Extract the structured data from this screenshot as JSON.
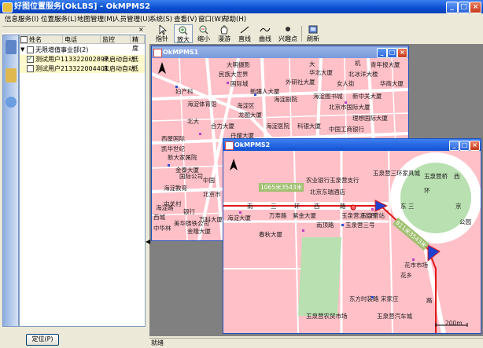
{
  "window": {
    "title": "好图位置服务[OkLBS] - OkMPMS2"
  },
  "menu": [
    "信息服务(I)",
    "位置服务(L)",
    "地图管理(M)",
    "人员管理(U)",
    "系统(S)",
    "查看(V)",
    "窗口(W)",
    "帮助(H)"
  ],
  "toolbar": {
    "tools": [
      "指针",
      "放大",
      "缩小",
      "漫游",
      "直线",
      "曲线",
      "兴趣点",
      "刷新"
    ]
  },
  "table": {
    "headers": [
      "姓名",
      "电话",
      "监控",
      "精度"
    ],
    "group": "无限增值事业部(2)",
    "rows": [
      {
        "name": "测试用户1",
        "phone": "13322002897",
        "status": "未启动自动",
        "precision": "低"
      },
      {
        "name": "测试用户2",
        "phone": "13322004401",
        "status": "未启动自动",
        "precision": "低"
      }
    ]
  },
  "locate_button": "定位(P)",
  "status_text": "就绪",
  "map1": {
    "title": "OkMPMS1",
    "labels": [
      "大明摄影",
      "大",
      "机",
      "青年报大厦",
      "民族大世界",
      "华北大厦",
      "北冰洋大楼",
      "国际城",
      "妇产科",
      "外研社大厦",
      "女人街",
      "华商大厦",
      "新疆人大厦",
      "海淀剧院",
      "海淀图书城",
      "新中关大厦",
      "北京市国际大厦",
      "海淀区",
      "海淀体育馆",
      "龙图大厦",
      "理想国际大厦",
      "合力大厦",
      "丹耀大厦",
      "海淀医院",
      "北大",
      "科银大厦",
      "中国工商银行",
      "西屋国际",
      "凯华世纪",
      "新大家属院",
      "金泰大厦",
      "国际公司",
      "中国",
      "海淀教育",
      "北京市",
      "中关村",
      "银行",
      "美华铸铁公司",
      "海淀路",
      "西城",
      "金隆大厦",
      "中华林",
      "万科大厦"
    ]
  },
  "map2": {
    "title": "OkMPMS2",
    "labels": [
      "玉泉营三环家具城",
      "农业银行玉泉营支行",
      "北京东瑞酒店",
      "京",
      "玉泉营桥",
      "环",
      "南",
      "三",
      "环",
      "西",
      "路",
      "万寿路",
      "紫金大厦",
      "玉泉营派出所",
      "东",
      "南顶路",
      "海淀大厦",
      "玉泉营三号",
      "玉泉营站",
      "三",
      "花市市场",
      "花乡",
      "东方时装路",
      "宋家庄",
      "玉泉营农贸市场",
      "玉泉营汽车城",
      "春秋大厦",
      "路",
      "公园",
      "西"
    ],
    "track_labels": [
      "1065米3543米",
      "811米3543米"
    ],
    "scale": "200m"
  },
  "colors": {
    "map_bg": "#ffc0c8",
    "road": "#ffffff",
    "park": "#b8e0b0",
    "track": "#e01818",
    "title_blue": "#0a4fd0"
  }
}
